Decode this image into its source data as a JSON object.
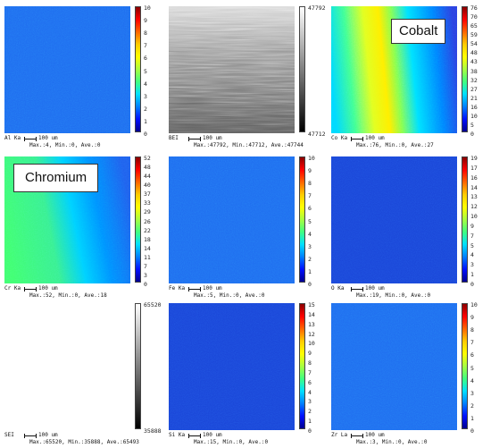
{
  "labels": {
    "cobalt": "Cobalt",
    "chromium": "Chromium"
  },
  "panels": [
    {
      "element": "Al Ka",
      "scale": "100 um",
      "stats": "Max.:4, Min.:0, Ave.:0",
      "ticks": [
        "10",
        "9",
        "8",
        "7",
        "6",
        "5",
        "4",
        "3",
        "2",
        "1",
        "0"
      ],
      "colorbar": "jet",
      "map": "uniform-blue"
    },
    {
      "element": "BEI",
      "scale": "100 um",
      "stats": "Max.:47792, Min.:47712, Ave.:47744",
      "ticks": [
        "47792",
        "47712"
      ],
      "colorbar": "gray",
      "map": "gray-noise"
    },
    {
      "element": "Co Ka",
      "scale": "100 um",
      "stats": "Max.:76, Min.:0, Ave.:27",
      "ticks": [
        "76",
        "70",
        "65",
        "59",
        "54",
        "48",
        "43",
        "38",
        "32",
        "27",
        "21",
        "16",
        "10",
        "5",
        "0"
      ],
      "colorbar": "jet",
      "map": "cobalt-band"
    },
    {
      "element": "Cr Ka",
      "scale": "100 um",
      "stats": "Max.:52, Min.:0, Ave.:18",
      "ticks": [
        "52",
        "48",
        "44",
        "40",
        "37",
        "33",
        "29",
        "26",
        "22",
        "18",
        "14",
        "11",
        "7",
        "3",
        "0"
      ],
      "colorbar": "jet",
      "map": "chromium-gradient"
    },
    {
      "element": "Fe Ka",
      "scale": "100 um",
      "stats": "Max.:5, Min.:0, Ave.:0",
      "ticks": [
        "10",
        "9",
        "8",
        "7",
        "6",
        "5",
        "4",
        "3",
        "2",
        "1",
        "0"
      ],
      "colorbar": "jet",
      "map": "uniform-blue"
    },
    {
      "element": "O Ka",
      "scale": "100 um",
      "stats": "Max.:19, Min.:0, Ave.:0",
      "ticks": [
        "19",
        "17",
        "16",
        "14",
        "13",
        "12",
        "10",
        "9",
        "7",
        "5",
        "4",
        "3",
        "1",
        "0"
      ],
      "colorbar": "jet",
      "map": "dark-blue"
    },
    {
      "element": "SEI",
      "scale": "100 um",
      "stats": "Max.:65520, Min.:35888, Ave.:65493",
      "ticks": [
        "65520",
        "35888"
      ],
      "colorbar": "gray",
      "map": "white"
    },
    {
      "element": "Si Ka",
      "scale": "100 um",
      "stats": "Max.:15, Min.:0, Ave.:0",
      "ticks": [
        "15",
        "14",
        "13",
        "12",
        "10",
        "9",
        "8",
        "7",
        "6",
        "4",
        "3",
        "2",
        "1",
        "0"
      ],
      "colorbar": "jet",
      "map": "dark-blue"
    },
    {
      "element": "Zr La",
      "scale": "100 um",
      "stats": "Max.:3, Min.:0, Ave.:0",
      "ticks": [
        "10",
        "9",
        "8",
        "7",
        "6",
        "5",
        "4",
        "3",
        "2",
        "1",
        "0"
      ],
      "colorbar": "jet",
      "map": "uniform-blue"
    }
  ]
}
